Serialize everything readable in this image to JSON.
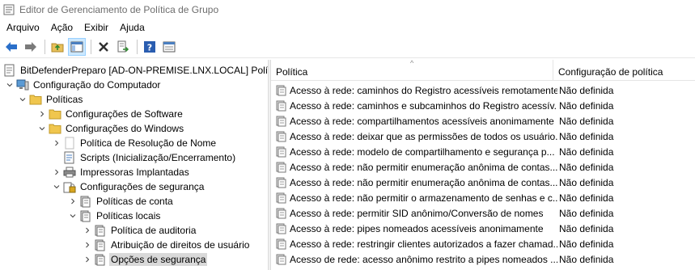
{
  "window": {
    "title": "Editor de Gerenciamento de Política de Grupo"
  },
  "menu": [
    "Arquivo",
    "Ação",
    "Exibir",
    "Ajuda"
  ],
  "toolbar": {
    "buttons": [
      "back-icon",
      "forward-icon",
      "up-folder-icon",
      "show-hide-tree-icon",
      "delete-icon",
      "export-list-icon",
      "help-icon",
      "properties-icon"
    ]
  },
  "tree": {
    "items": [
      {
        "label": "BitDefenderPreparo [AD-ON-PREMISE.LNX.LOCAL] Polític",
        "icon": "gpo-icon"
      },
      {
        "label": "Configuração do Computador",
        "icon": "computer-icon"
      },
      {
        "label": "Políticas",
        "icon": "folder-icon"
      },
      {
        "label": "Configurações de Software",
        "icon": "folder-icon"
      },
      {
        "label": "Configurações do Windows",
        "icon": "folder-icon"
      },
      {
        "label": "Política de Resolução de Nome",
        "icon": "document-icon"
      },
      {
        "label": "Scripts (Inicialização/Encerramento)",
        "icon": "script-icon"
      },
      {
        "label": "Impressoras Implantadas",
        "icon": "printer-icon"
      },
      {
        "label": "Configurações de segurança",
        "icon": "security-settings-icon"
      },
      {
        "label": "Políticas de conta",
        "icon": "policy-icon"
      },
      {
        "label": "Políticas locais",
        "icon": "policy-icon"
      },
      {
        "label": "Política de auditoria",
        "icon": "policy-icon"
      },
      {
        "label": "Atribuição de direitos de usuário",
        "icon": "policy-icon"
      },
      {
        "label": "Opções de segurança",
        "icon": "policy-icon"
      }
    ]
  },
  "list": {
    "columns": [
      "Política",
      "Configuração de política"
    ],
    "rows": [
      {
        "policy": "Acesso à rede: caminhos do Registro acessíveis remotamente",
        "setting": "Não definida"
      },
      {
        "policy": "Acesso à rede: caminhos e subcaminhos do Registro acessív...",
        "setting": "Não definida"
      },
      {
        "policy": "Acesso à rede: compartilhamentos acessíveis anonimamente",
        "setting": "Não definida"
      },
      {
        "policy": "Acesso à rede: deixar que as permissões de todos os usuário...",
        "setting": "Não definida"
      },
      {
        "policy": "Acesso à rede: modelo de compartilhamento e segurança p...",
        "setting": "Não definida"
      },
      {
        "policy": "Acesso à rede: não permitir enumeração anônima de contas...",
        "setting": "Não definida"
      },
      {
        "policy": "Acesso à rede: não permitir enumeração anônima de contas...",
        "setting": "Não definida"
      },
      {
        "policy": "Acesso à rede: não permitir o armazenamento de senhas e c...",
        "setting": "Não definida"
      },
      {
        "policy": "Acesso à rede: permitir SID anônimo/Conversão de nomes",
        "setting": "Não definida"
      },
      {
        "policy": "Acesso à rede: pipes nomeados acessíveis anonimamente",
        "setting": "Não definida"
      },
      {
        "policy": "Acesso à rede: restringir clientes autorizados a fazer chamad...",
        "setting": "Não definida"
      },
      {
        "policy": "Acesso de rede: acesso anônimo restrito a pipes nomeados ...",
        "setting": "Não definida"
      }
    ]
  }
}
